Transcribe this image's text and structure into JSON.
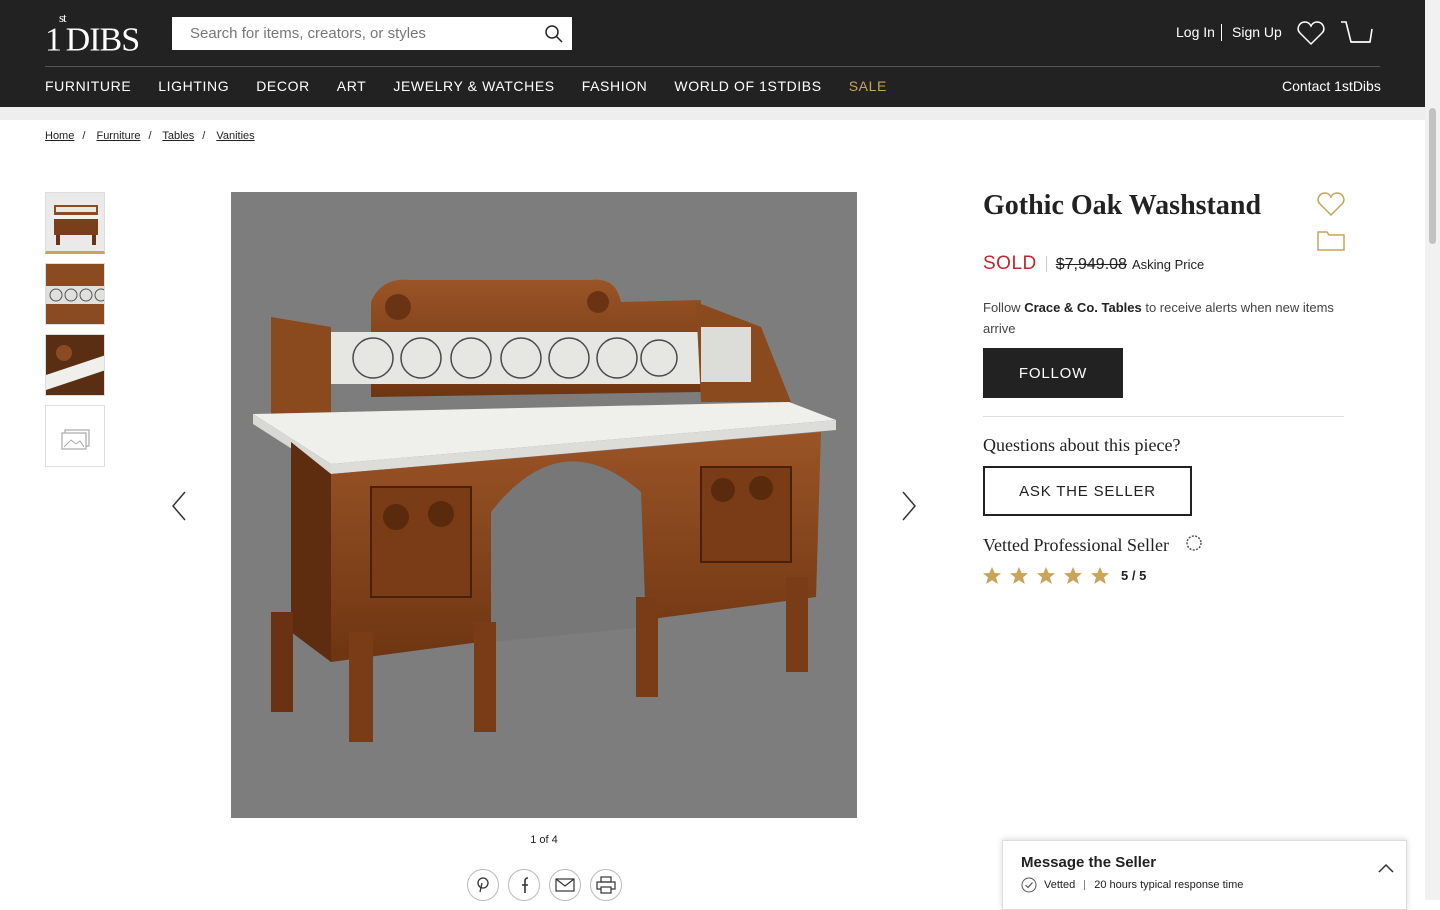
{
  "header": {
    "logo_main": "1",
    "logo_sup": "st",
    "logo_rest": "DIBS",
    "search_placeholder": "Search for items, creators, or styles",
    "login": "Log In",
    "signup": "Sign Up",
    "contact": "Contact 1stDibs"
  },
  "nav": [
    {
      "label": "FURNITURE"
    },
    {
      "label": "LIGHTING"
    },
    {
      "label": "DECOR"
    },
    {
      "label": "ART"
    },
    {
      "label": "JEWELRY & WATCHES"
    },
    {
      "label": "FASHION"
    },
    {
      "label": "WORLD OF 1STDIBS"
    },
    {
      "label": "SALE"
    }
  ],
  "breadcrumb": [
    "Home",
    "Furniture",
    "Tables",
    "Vanities"
  ],
  "gallery": {
    "counter": "1 of 4"
  },
  "product": {
    "title": "Gothic Oak Washstand",
    "status": "SOLD",
    "price": "$7,949.08",
    "price_label": "Asking Price",
    "follow_prefix": "Follow ",
    "follow_name": "Crace & Co. Tables",
    "follow_suffix": " to receive alerts when new items arrive",
    "follow_button": "FOLLOW",
    "questions": "Questions about this piece?",
    "ask_button": "ASK THE SELLER",
    "vetted_title": "Vetted Professional Seller",
    "rating": "5 / 5"
  },
  "message": {
    "title": "Message the Seller",
    "vetted": "Vetted",
    "response": "20 hours typical response time"
  },
  "colors": {
    "header_bg": "#222222",
    "accent_gold": "#c9a45a",
    "sold_red": "#c2262e"
  }
}
